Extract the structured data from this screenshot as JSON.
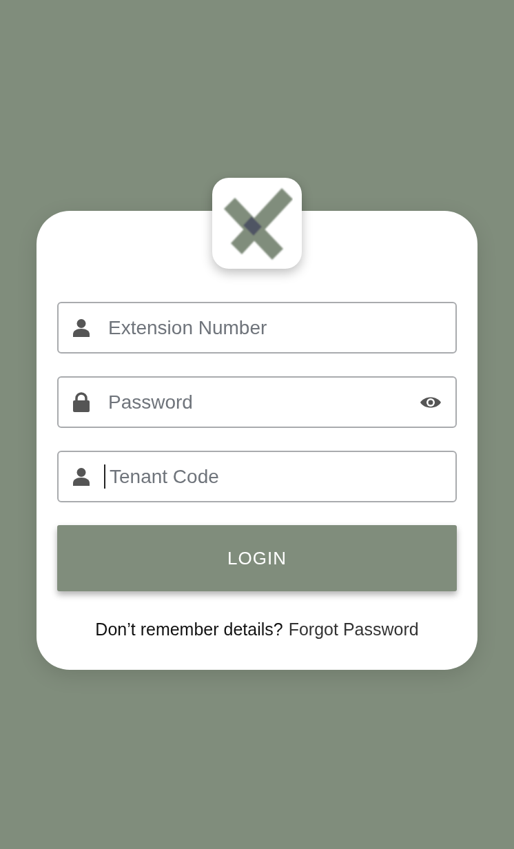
{
  "fields": [
    {
      "kind": "user",
      "placeholder": "Extension Number",
      "reveal_toggle": false,
      "focused": false
    },
    {
      "kind": "lock",
      "placeholder": "Password",
      "reveal_toggle": true,
      "focused": false
    },
    {
      "kind": "user",
      "placeholder": "Tenant Code",
      "reveal_toggle": false,
      "focused": true
    }
  ],
  "login_button": {
    "label": "LOGIN"
  },
  "footer": {
    "prompt": "Don’t remember details?",
    "link": "Forgot Password"
  }
}
